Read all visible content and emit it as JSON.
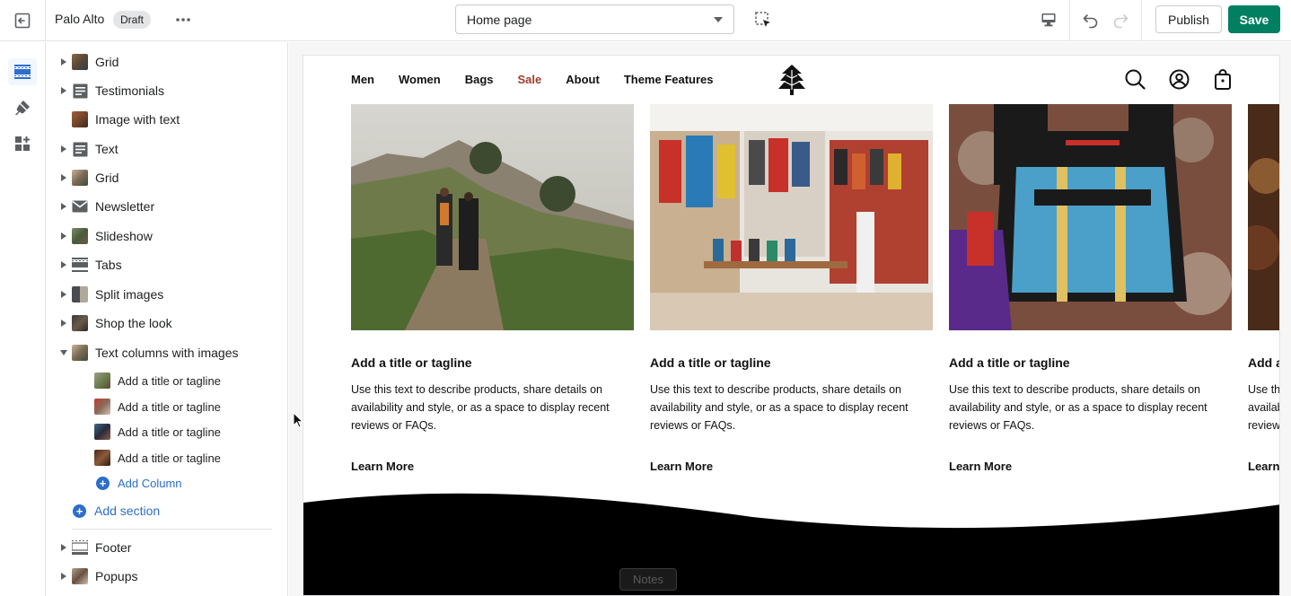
{
  "topbar": {
    "store_name": "Palo Alto",
    "status_badge": "Draft",
    "page_selector": "Home page",
    "publish_label": "Publish",
    "save_label": "Save",
    "accent_color": "#008060"
  },
  "rail": {
    "items": [
      {
        "icon": "sections-icon",
        "active": true
      },
      {
        "icon": "theme-settings-icon",
        "active": false
      },
      {
        "icon": "app-embeds-icon",
        "active": false
      }
    ]
  },
  "sections": {
    "items": [
      {
        "label": "Grid",
        "icon": "image-thumb",
        "expandable": true
      },
      {
        "label": "Testimonials",
        "icon": "text-block-icon",
        "expandable": true
      },
      {
        "label": "Image with text",
        "icon": "image-thumb",
        "expandable": false
      },
      {
        "label": "Text",
        "icon": "text-block-icon",
        "expandable": true
      },
      {
        "label": "Grid",
        "icon": "image-thumb",
        "expandable": true
      },
      {
        "label": "Newsletter",
        "icon": "envelope-icon",
        "expandable": true
      },
      {
        "label": "Slideshow",
        "icon": "image-thumb",
        "expandable": true
      },
      {
        "label": "Tabs",
        "icon": "tabs-icon",
        "expandable": true
      },
      {
        "label": "Split images",
        "icon": "image-thumb",
        "expandable": true
      },
      {
        "label": "Shop the look",
        "icon": "image-thumb",
        "expandable": true
      },
      {
        "label": "Text columns with images",
        "icon": "image-thumb",
        "expandable": true,
        "expanded": true
      }
    ],
    "columns": [
      {
        "label": "Add a title or tagline"
      },
      {
        "label": "Add a title or tagline"
      },
      {
        "label": "Add a title or tagline"
      },
      {
        "label": "Add a title or tagline"
      }
    ],
    "add_column_label": "Add Column",
    "add_section_label": "Add section",
    "footer_items": [
      {
        "label": "Footer",
        "icon": "footer-icon"
      },
      {
        "label": "Popups",
        "icon": "image-thumb"
      }
    ]
  },
  "store_preview": {
    "nav": [
      "Men",
      "Women",
      "Bags",
      "Sale",
      "About",
      "Theme Features"
    ],
    "sale_color": "#a03c2e",
    "columns": [
      {
        "title": "Add a title or tagline",
        "text": "Use this text to describe products, share details on availability and style, or as a space to display recent reviews or FAQs.",
        "link": "Learn More"
      },
      {
        "title": "Add a title or tagline",
        "text": "Use this text to describe products, share details on availability and style, or as a space to display recent reviews or FAQs.",
        "link": "Learn More"
      },
      {
        "title": "Add a title or tagline",
        "text": "Use this text to describe products, share details on availability and style, or as a space to display recent reviews or FAQs.",
        "link": "Learn More"
      },
      {
        "title": "Add a title or tagline",
        "text": "Use this text to describe products, share details on availability and style, or as a space to display recent reviews or FAQs.",
        "link": "Learn More"
      }
    ]
  },
  "notes_label": "Notes"
}
